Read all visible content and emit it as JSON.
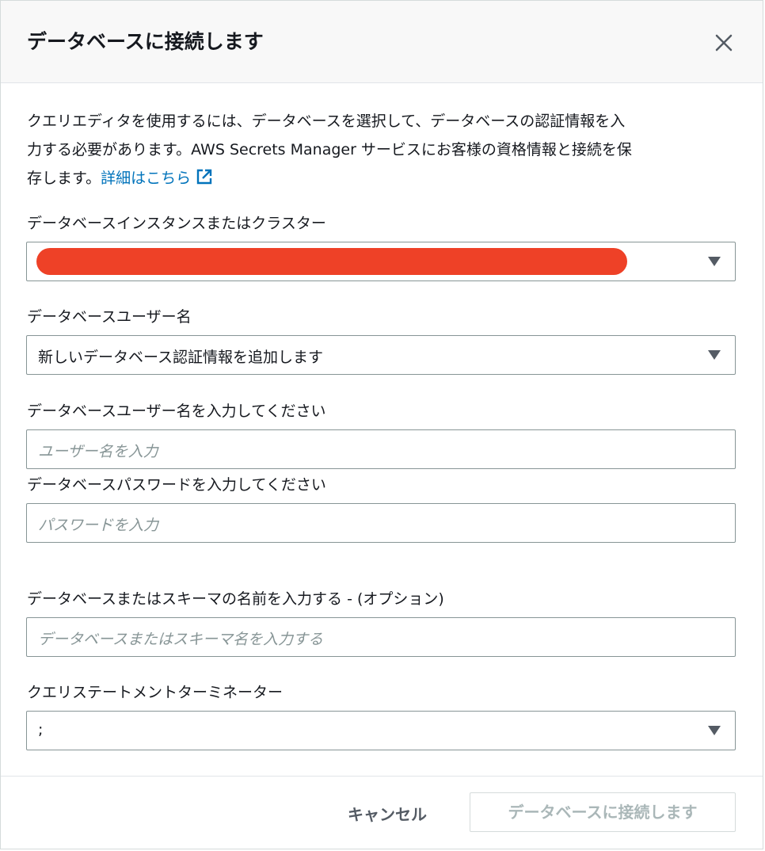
{
  "dialog": {
    "title": "データベースに接続します",
    "close_icon": "close-icon"
  },
  "intro": {
    "line1": "クエリエディタを使用するには、データベースを選択して、データベースの認証情報を入",
    "line2": "力する必要があります。AWS Secrets Manager サービスにお客様の資格情報と接続を保",
    "line3": "存します。",
    "link_text": "詳細はこちら",
    "link_icon": "external-link-icon"
  },
  "fields": {
    "instance": {
      "label": "データベースインスタンスまたはクラスター",
      "redacted_color": "#ee4127"
    },
    "username_mode": {
      "label": "データベースユーザー名",
      "value": "新しいデータベース認証情報を追加します"
    },
    "username": {
      "label": "データベースユーザー名を入力してください",
      "placeholder": "ユーザー名を入力"
    },
    "password": {
      "label": "データベースパスワードを入力してください",
      "placeholder": "パスワードを入力"
    },
    "schema": {
      "label": "データベースまたはスキーマの名前を入力する - (オプション)",
      "placeholder": "データベースまたはスキーマ名を入力する"
    },
    "terminator": {
      "label": "クエリステートメントターミネーター",
      "value": ";"
    }
  },
  "footer": {
    "cancel_label": "キャンセル",
    "connect_label": "データベースに接続します"
  },
  "colors": {
    "link": "#0073bb",
    "disabled_text": "#aab7b8",
    "border": "#879596"
  }
}
